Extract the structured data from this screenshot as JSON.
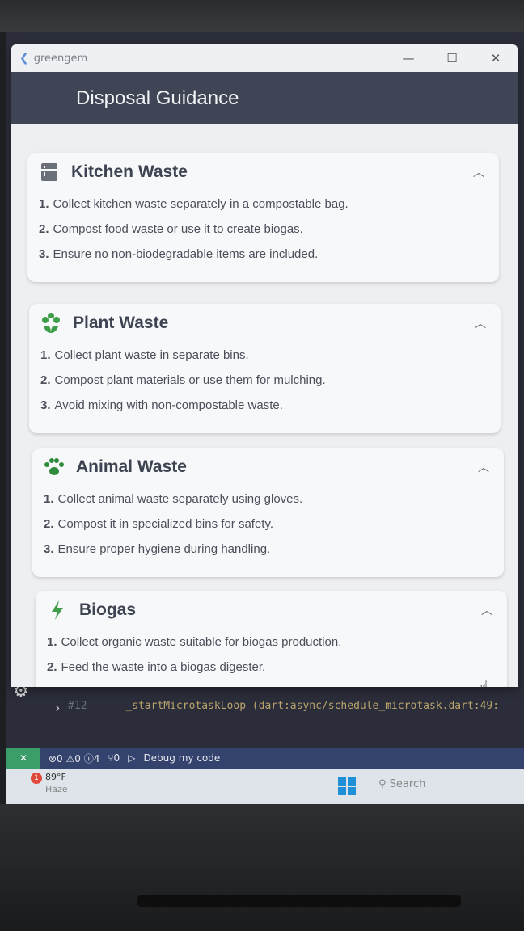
{
  "window": {
    "app_name": "greengem",
    "minimize": "—",
    "maximize": "☐",
    "close": "✕"
  },
  "page": {
    "title": "Disposal Guidance"
  },
  "sections": [
    {
      "title": "Kitchen Waste",
      "icon": "kitchen-icon",
      "steps": [
        {
          "num": "1.",
          "text": "Collect kitchen waste separately in a compostable bag."
        },
        {
          "num": "2.",
          "text": "Compost food waste or use it to create biogas."
        },
        {
          "num": "3.",
          "text": "Ensure no non-biodegradable items are included."
        }
      ]
    },
    {
      "title": "Plant Waste",
      "icon": "flower-icon",
      "steps": [
        {
          "num": "1.",
          "text": "Collect plant waste in separate bins."
        },
        {
          "num": "2.",
          "text": "Compost plant materials or use them for mulching."
        },
        {
          "num": "3.",
          "text": "Avoid mixing with non-compostable waste."
        }
      ]
    },
    {
      "title": "Animal Waste",
      "icon": "paw-icon",
      "steps": [
        {
          "num": "1.",
          "text": "Collect animal waste separately using gloves."
        },
        {
          "num": "2.",
          "text": "Compost it in specialized bins for safety."
        },
        {
          "num": "3.",
          "text": "Ensure proper hygiene during handling."
        }
      ]
    },
    {
      "title": "Biogas",
      "icon": "bolt-icon",
      "steps": [
        {
          "num": "1.",
          "text": "Collect organic waste suitable for biogas production."
        },
        {
          "num": "2.",
          "text": "Feed the waste into a biogas digester."
        }
      ]
    }
  ],
  "ide": {
    "line_num": "#12",
    "line_text": "_startMicrotaskLoop (dart:async/schedule_microtask.dart:49:",
    "statusbar": {
      "problems": "⊗0 ⚠0 ⓘ4",
      "ports": "⑂0",
      "debug": "Debug my code"
    }
  },
  "taskbar": {
    "weather_temp": "89°F",
    "weather_cond": "Haze",
    "search_placeholder": "Search"
  },
  "colors": {
    "accent_green": "#3e9e4a",
    "appbar": "#3f4555"
  }
}
